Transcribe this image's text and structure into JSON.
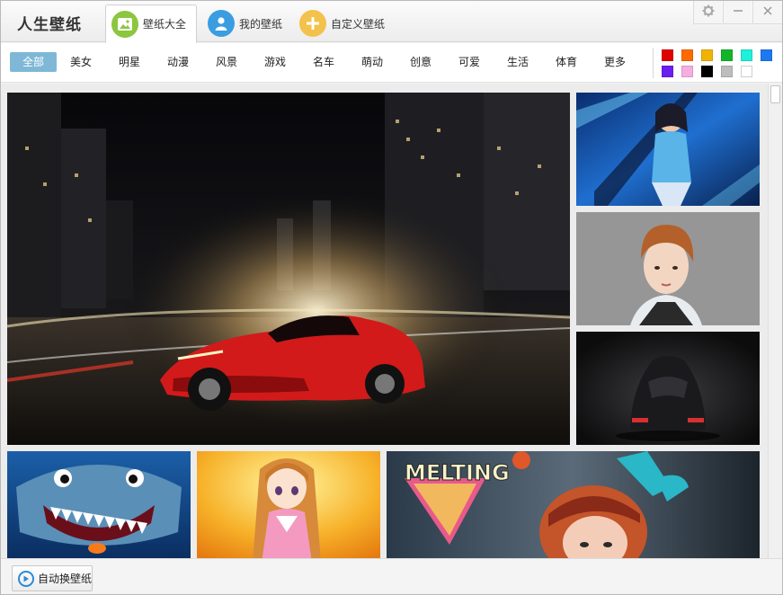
{
  "app": {
    "title": "人生壁纸"
  },
  "tabs": [
    {
      "label": "壁纸大全",
      "active": true,
      "icon": "picture-icon",
      "color": "#8cc63f"
    },
    {
      "label": "我的壁纸",
      "active": false,
      "icon": "user-icon",
      "color": "#3a9de0"
    },
    {
      "label": "自定义壁纸",
      "active": false,
      "icon": "plus-icon",
      "color": "#f3c24c"
    }
  ],
  "window_controls": {
    "settings": "gear-icon",
    "minimize": "minimize-icon",
    "close": "close-icon"
  },
  "categories": [
    "全部",
    "美女",
    "明星",
    "动漫",
    "风景",
    "游戏",
    "名车",
    "萌动",
    "创意",
    "可爱",
    "生活",
    "体育",
    "更多"
  ],
  "active_category": "全部",
  "color_filters": [
    "#e00000",
    "#ff6a00",
    "#f0b400",
    "#12b52a",
    "#1ff0d8",
    "#1e78f0",
    "#6a1ef0",
    "#f6aee0",
    "#000000",
    "#bdbdbd",
    "#ffffff"
  ],
  "wallpapers": [
    {
      "subject": "red sports car in city"
    },
    {
      "subject": "anime game fighter girl"
    },
    {
      "subject": "portrait of young man"
    },
    {
      "subject": "black sports car"
    },
    {
      "subject": "cartoon shark"
    },
    {
      "subject": "anime girl"
    },
    {
      "subject": "melting poster girl"
    }
  ],
  "footer": {
    "auto_change_label": "自动换壁纸"
  }
}
